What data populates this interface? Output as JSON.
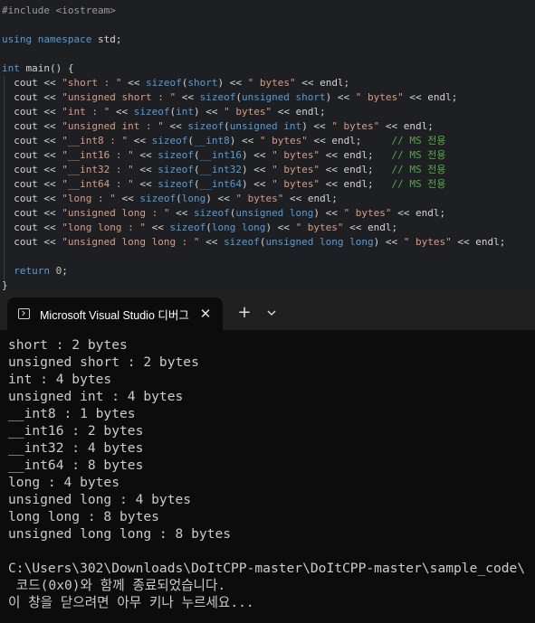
{
  "editor": {
    "lines": [
      [
        {
          "c": "pp",
          "t": "#include <iostream>"
        }
      ],
      [],
      [
        {
          "c": "kw",
          "t": "using namespace "
        },
        {
          "c": "tx",
          "t": "std;"
        }
      ],
      [],
      [
        {
          "c": "kw",
          "t": "int "
        },
        {
          "c": "tx",
          "t": "main() {"
        }
      ],
      [
        {
          "c": "tx",
          "t": "  cout << "
        },
        {
          "c": "str",
          "t": "\"short : \""
        },
        {
          "c": "tx",
          "t": " << "
        },
        {
          "c": "kw",
          "t": "sizeof"
        },
        {
          "c": "tx",
          "t": "("
        },
        {
          "c": "kw",
          "t": "short"
        },
        {
          "c": "tx",
          "t": ") << "
        },
        {
          "c": "str",
          "t": "\" bytes\""
        },
        {
          "c": "tx",
          "t": " << endl;"
        }
      ],
      [
        {
          "c": "tx",
          "t": "  cout << "
        },
        {
          "c": "str",
          "t": "\"unsigned short : \""
        },
        {
          "c": "tx",
          "t": " << "
        },
        {
          "c": "kw",
          "t": "sizeof"
        },
        {
          "c": "tx",
          "t": "("
        },
        {
          "c": "kw",
          "t": "unsigned short"
        },
        {
          "c": "tx",
          "t": ") << "
        },
        {
          "c": "str",
          "t": "\" bytes\""
        },
        {
          "c": "tx",
          "t": " << endl;"
        }
      ],
      [
        {
          "c": "tx",
          "t": "  cout << "
        },
        {
          "c": "str",
          "t": "\"int : \""
        },
        {
          "c": "tx",
          "t": " << "
        },
        {
          "c": "kw",
          "t": "sizeof"
        },
        {
          "c": "tx",
          "t": "("
        },
        {
          "c": "kw",
          "t": "int"
        },
        {
          "c": "tx",
          "t": ") << "
        },
        {
          "c": "str",
          "t": "\" bytes\""
        },
        {
          "c": "tx",
          "t": " << endl;"
        }
      ],
      [
        {
          "c": "tx",
          "t": "  cout << "
        },
        {
          "c": "str",
          "t": "\"unsigned int : \""
        },
        {
          "c": "tx",
          "t": " << "
        },
        {
          "c": "kw",
          "t": "sizeof"
        },
        {
          "c": "tx",
          "t": "("
        },
        {
          "c": "kw",
          "t": "unsigned int"
        },
        {
          "c": "tx",
          "t": ") << "
        },
        {
          "c": "str",
          "t": "\" bytes\""
        },
        {
          "c": "tx",
          "t": " << endl;"
        }
      ],
      [
        {
          "c": "tx",
          "t": "  cout << "
        },
        {
          "c": "str",
          "t": "\"__int8 : \""
        },
        {
          "c": "tx",
          "t": " << "
        },
        {
          "c": "kw",
          "t": "sizeof"
        },
        {
          "c": "tx",
          "t": "("
        },
        {
          "c": "kw",
          "t": "__int8"
        },
        {
          "c": "tx",
          "t": ") << "
        },
        {
          "c": "str",
          "t": "\" bytes\""
        },
        {
          "c": "tx",
          "t": " << endl;     "
        },
        {
          "c": "cmt",
          "t": "// MS 전용"
        }
      ],
      [
        {
          "c": "tx",
          "t": "  cout << "
        },
        {
          "c": "str",
          "t": "\"__int16 : \""
        },
        {
          "c": "tx",
          "t": " << "
        },
        {
          "c": "kw",
          "t": "sizeof"
        },
        {
          "c": "tx",
          "t": "("
        },
        {
          "c": "kw",
          "t": "__int16"
        },
        {
          "c": "tx",
          "t": ") << "
        },
        {
          "c": "str",
          "t": "\" bytes\""
        },
        {
          "c": "tx",
          "t": " << endl;   "
        },
        {
          "c": "cmt",
          "t": "// MS 전용"
        }
      ],
      [
        {
          "c": "tx",
          "t": "  cout << "
        },
        {
          "c": "str",
          "t": "\"__int32 : \""
        },
        {
          "c": "tx",
          "t": " << "
        },
        {
          "c": "kw",
          "t": "sizeof"
        },
        {
          "c": "tx",
          "t": "("
        },
        {
          "c": "kw",
          "t": "__int32"
        },
        {
          "c": "tx",
          "t": ") << "
        },
        {
          "c": "str",
          "t": "\" bytes\""
        },
        {
          "c": "tx",
          "t": " << endl;   "
        },
        {
          "c": "cmt",
          "t": "// MS 전용"
        }
      ],
      [
        {
          "c": "tx",
          "t": "  cout << "
        },
        {
          "c": "str",
          "t": "\"__int64 : \""
        },
        {
          "c": "tx",
          "t": " << "
        },
        {
          "c": "kw",
          "t": "sizeof"
        },
        {
          "c": "tx",
          "t": "("
        },
        {
          "c": "kw",
          "t": "__int64"
        },
        {
          "c": "tx",
          "t": ") << "
        },
        {
          "c": "str",
          "t": "\" bytes\""
        },
        {
          "c": "tx",
          "t": " << endl;   "
        },
        {
          "c": "cmt",
          "t": "// MS 전용"
        }
      ],
      [
        {
          "c": "tx",
          "t": "  cout << "
        },
        {
          "c": "str",
          "t": "\"long : \""
        },
        {
          "c": "tx",
          "t": " << "
        },
        {
          "c": "kw",
          "t": "sizeof"
        },
        {
          "c": "tx",
          "t": "("
        },
        {
          "c": "kw",
          "t": "long"
        },
        {
          "c": "tx",
          "t": ") << "
        },
        {
          "c": "str",
          "t": "\" bytes\""
        },
        {
          "c": "tx",
          "t": " << endl;"
        }
      ],
      [
        {
          "c": "tx",
          "t": "  cout << "
        },
        {
          "c": "str",
          "t": "\"unsigned long : \""
        },
        {
          "c": "tx",
          "t": " << "
        },
        {
          "c": "kw",
          "t": "sizeof"
        },
        {
          "c": "tx",
          "t": "("
        },
        {
          "c": "kw",
          "t": "unsigned long"
        },
        {
          "c": "tx",
          "t": ") << "
        },
        {
          "c": "str",
          "t": "\" bytes\""
        },
        {
          "c": "tx",
          "t": " << endl;"
        }
      ],
      [
        {
          "c": "tx",
          "t": "  cout << "
        },
        {
          "c": "str",
          "t": "\"long long : \""
        },
        {
          "c": "tx",
          "t": " << "
        },
        {
          "c": "kw",
          "t": "sizeof"
        },
        {
          "c": "tx",
          "t": "("
        },
        {
          "c": "kw",
          "t": "long long"
        },
        {
          "c": "tx",
          "t": ") << "
        },
        {
          "c": "str",
          "t": "\" bytes\""
        },
        {
          "c": "tx",
          "t": " << endl;"
        }
      ],
      [
        {
          "c": "tx",
          "t": "  cout << "
        },
        {
          "c": "str",
          "t": "\"unsigned long long : \""
        },
        {
          "c": "tx",
          "t": " << "
        },
        {
          "c": "kw",
          "t": "sizeof"
        },
        {
          "c": "tx",
          "t": "("
        },
        {
          "c": "kw",
          "t": "unsigned long long"
        },
        {
          "c": "tx",
          "t": ") << "
        },
        {
          "c": "str",
          "t": "\" bytes\""
        },
        {
          "c": "tx",
          "t": " << endl;"
        }
      ],
      [],
      [
        {
          "c": "kw",
          "t": "  return "
        },
        {
          "c": "num",
          "t": "0"
        },
        {
          "c": "tx",
          "t": ";"
        }
      ],
      [
        {
          "c": "tx",
          "t": "}"
        }
      ]
    ]
  },
  "terminal": {
    "tab_title": "Microsoft Visual Studio 디버그",
    "tab_icon": "terminal-icon",
    "close_glyph": "✕",
    "new_tab_glyph": "+",
    "output": [
      "short : 2 bytes",
      "unsigned short : 2 bytes",
      "int : 4 bytes",
      "unsigned int : 4 bytes",
      "__int8 : 1 bytes",
      "__int16 : 2 bytes",
      "__int32 : 4 bytes",
      "__int64 : 8 bytes",
      "long : 4 bytes",
      "unsigned long : 4 bytes",
      "long long : 8 bytes",
      "unsigned long long : 8 bytes",
      "",
      "C:\\Users\\302\\Downloads\\DoItCPP-master\\DoItCPP-master\\sample_code\\",
      " 코드(0x0)와 함께 종료되었습니다.",
      "이 창을 닫으려면 아무 키나 누르세요..."
    ]
  },
  "colors": {
    "editor_bg": "#1e1f22",
    "keyword": "#569cd6",
    "string": "#d69d85",
    "comment": "#57a64a",
    "terminal_bg": "#0c0c0c",
    "terminal_text": "#cccccc"
  }
}
